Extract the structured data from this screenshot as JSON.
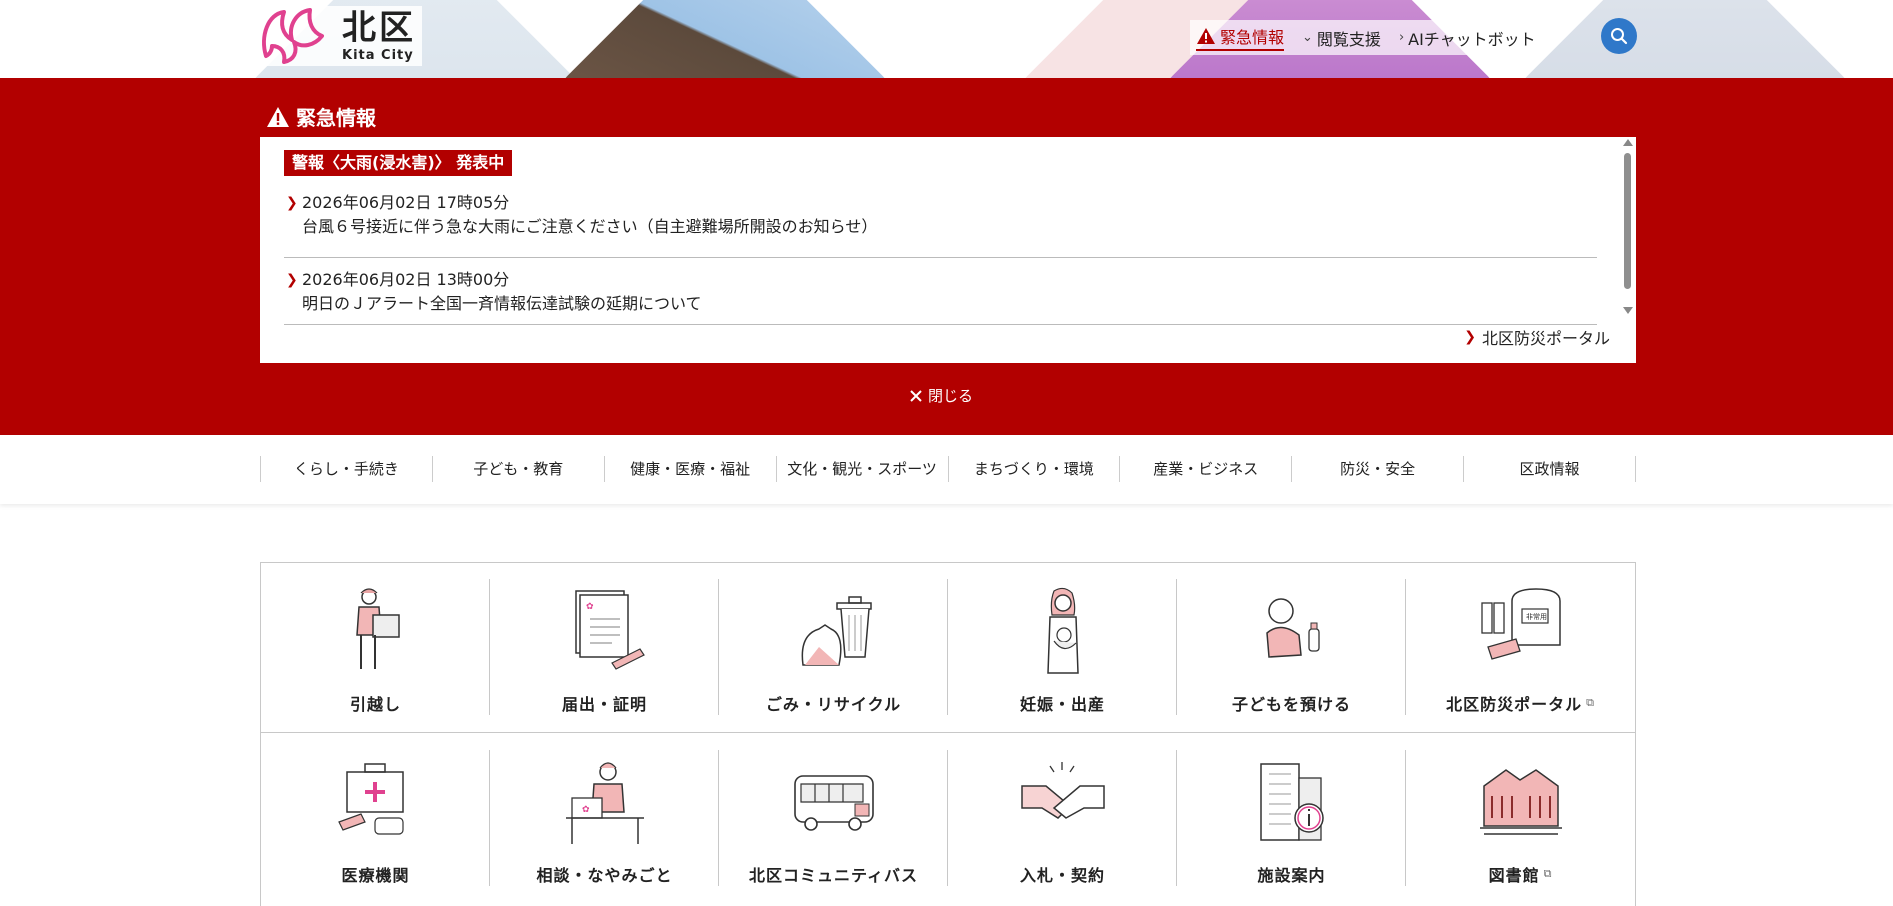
{
  "header": {
    "logo_kanji": "北区",
    "logo_en": "Kita City",
    "util": {
      "emergency": "緊急情報",
      "reading_support": "閲覧支援",
      "ai_chatbot": "AIチャットボット"
    }
  },
  "emergency": {
    "title": "緊急情報",
    "badge": "警報〈大雨(浸水害)〉 発表中",
    "items": [
      {
        "date": "2026年06月02日 17時05分",
        "text": "台風６号接近に伴う急な大雨にご注意ください（自主避難場所開設のお知らせ）"
      },
      {
        "date": "2026年06月02日 13時00分",
        "text": "明日のＪアラート全国一斉情報伝達試験の延期について"
      }
    ],
    "portal_link": "北区防災ポータル",
    "close_label": "閉じる"
  },
  "nav": {
    "items": [
      "くらし・手続き",
      "子ども・教育",
      "健康・医療・福祉",
      "文化・観光・スポーツ",
      "まちづくり・環境",
      "産業・ビジネス",
      "防災・安全",
      "区政情報"
    ]
  },
  "quick_links": [
    {
      "label": "引越し",
      "icon": "moving-person-icon"
    },
    {
      "label": "届出・証明",
      "icon": "document-icon"
    },
    {
      "label": "ごみ・リサイクル",
      "icon": "garbage-icon"
    },
    {
      "label": "妊娠・出産",
      "icon": "mother-baby-icon"
    },
    {
      "label": "子どもを預ける",
      "icon": "baby-icon"
    },
    {
      "label": "北区防災ポータル",
      "icon": "emergency-kit-icon",
      "external": true
    },
    {
      "label": "医療機関",
      "icon": "medical-box-icon"
    },
    {
      "label": "相談・なやみごと",
      "icon": "consultation-icon"
    },
    {
      "label": "北区コミュニティバス",
      "icon": "bus-icon"
    },
    {
      "label": "入札・契約",
      "icon": "handshake-icon"
    },
    {
      "label": "施設案内",
      "icon": "building-info-icon"
    },
    {
      "label": "図書館",
      "icon": "library-icon",
      "external": true
    }
  ],
  "colors": {
    "accent": "#b20000",
    "search": "#2f78c9",
    "logo": "#e0418f"
  }
}
